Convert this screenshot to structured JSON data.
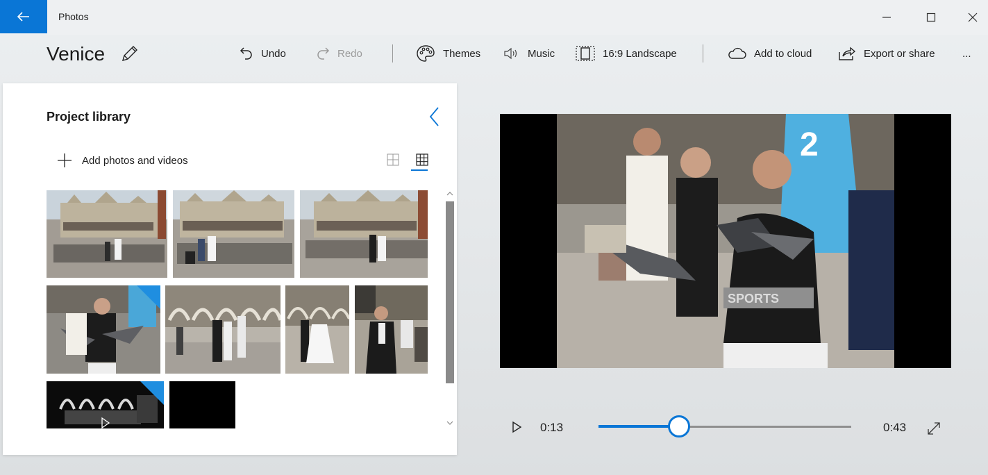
{
  "window": {
    "app_title": "Photos",
    "minimize_icon": "minimize-icon",
    "maximize_icon": "maximize-icon",
    "close_icon": "close-icon"
  },
  "toolbar": {
    "project_title": "Venice",
    "undo": "Undo",
    "redo": "Redo",
    "themes": "Themes",
    "music": "Music",
    "aspect": "16:9 Landscape",
    "add_to_cloud": "Add to cloud",
    "export": "Export or share",
    "more": "..."
  },
  "library": {
    "title": "Project library",
    "add_label": "Add photos and videos",
    "thumbnails": [
      {
        "kind": "photo",
        "scene": "plaza-basilica",
        "in_storyboard": false
      },
      {
        "kind": "photo",
        "scene": "plaza-basilica",
        "in_storyboard": false
      },
      {
        "kind": "photo",
        "scene": "plaza-basilica",
        "in_storyboard": false
      },
      {
        "kind": "photo",
        "scene": "pigeons-woman",
        "in_storyboard": true
      },
      {
        "kind": "photo",
        "scene": "arcade-couple",
        "in_storyboard": false
      },
      {
        "kind": "photo",
        "scene": "arcade-couple",
        "in_storyboard": false
      },
      {
        "kind": "photo",
        "scene": "man-dark-coat",
        "in_storyboard": false
      },
      {
        "kind": "video",
        "scene": "arcade-night",
        "in_storyboard": true
      },
      {
        "kind": "photo",
        "scene": "black",
        "in_storyboard": false
      }
    ]
  },
  "player": {
    "current_time": "0:13",
    "total_time": "0:43",
    "progress": 0.32
  },
  "colors": {
    "accent": "#0a76d6",
    "storyboard_badge": "#1f8ee0"
  }
}
